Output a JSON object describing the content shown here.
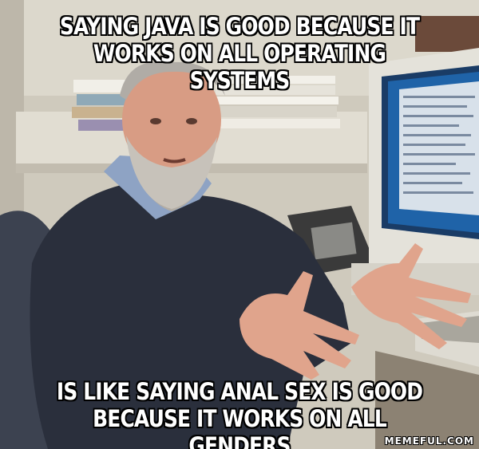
{
  "meme": {
    "top_text": "SAYING JAVA IS GOOD BECAUSE IT WORKS ON ALL OPERATING SYSTEMS",
    "bottom_text": "IS LIKE SAYING ANAL SEX IS GOOD BECAUSE IT WORKS ON ALL GENDERS",
    "watermark": "MEMEFUL.COM"
  },
  "colors": {
    "caption_fill": "#ffffff",
    "caption_outline": "#000000",
    "sweater": "#2a2f3c",
    "monitor": "#e4e2da",
    "screen": "#1f63a8"
  }
}
